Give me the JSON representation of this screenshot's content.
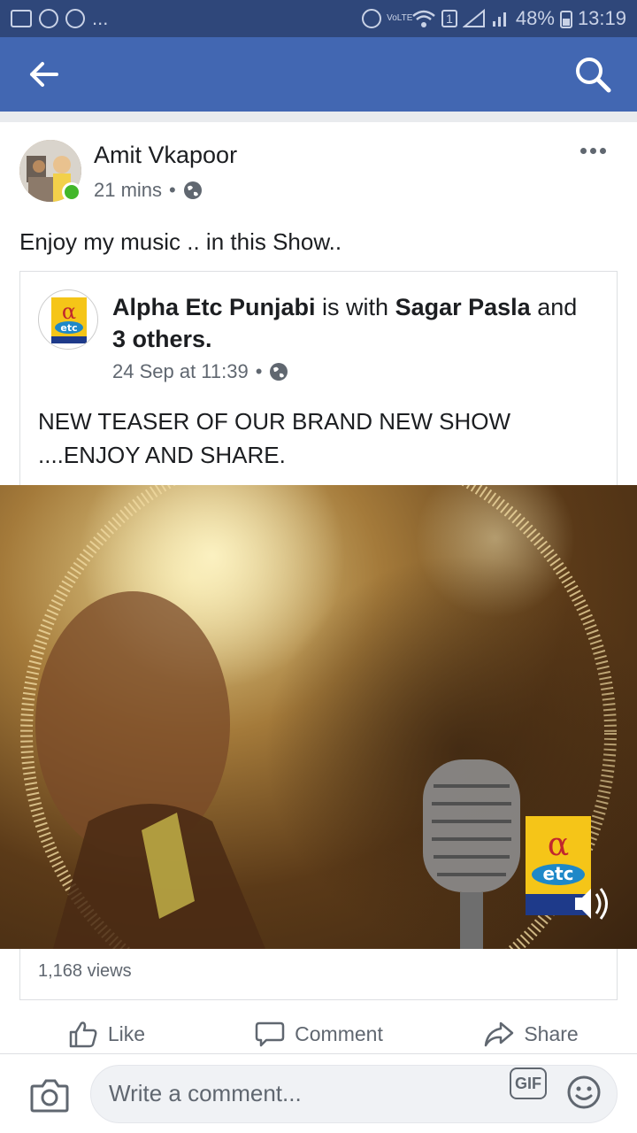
{
  "status_bar": {
    "battery": "48%",
    "time": "13:19",
    "network": "VoLTE",
    "sim": "1"
  },
  "post": {
    "author": "Amit Vkapoor",
    "time": "21 mins",
    "separator": "•",
    "text": "Enjoy my music .. in this Show.."
  },
  "shared": {
    "page": "Alpha Etc Punjabi",
    "with_text": "is with",
    "tagged": "Sagar Pasla",
    "and_text": "and",
    "others": "3 others.",
    "time": "24 Sep at 11:39",
    "separator": "•",
    "text": "NEW TEASER OF OUR BRAND NEW SHOW ....ENJOY AND SHARE."
  },
  "video": {
    "views": "1,168 views",
    "logo_alpha": "α",
    "logo_etc": "etc",
    "logo_sub": "ਪੰਜਾਬੀ"
  },
  "actions": {
    "like": "Like",
    "comment": "Comment",
    "share": "Share"
  },
  "comment_bar": {
    "placeholder": "Write a comment...",
    "gif": "GIF"
  }
}
